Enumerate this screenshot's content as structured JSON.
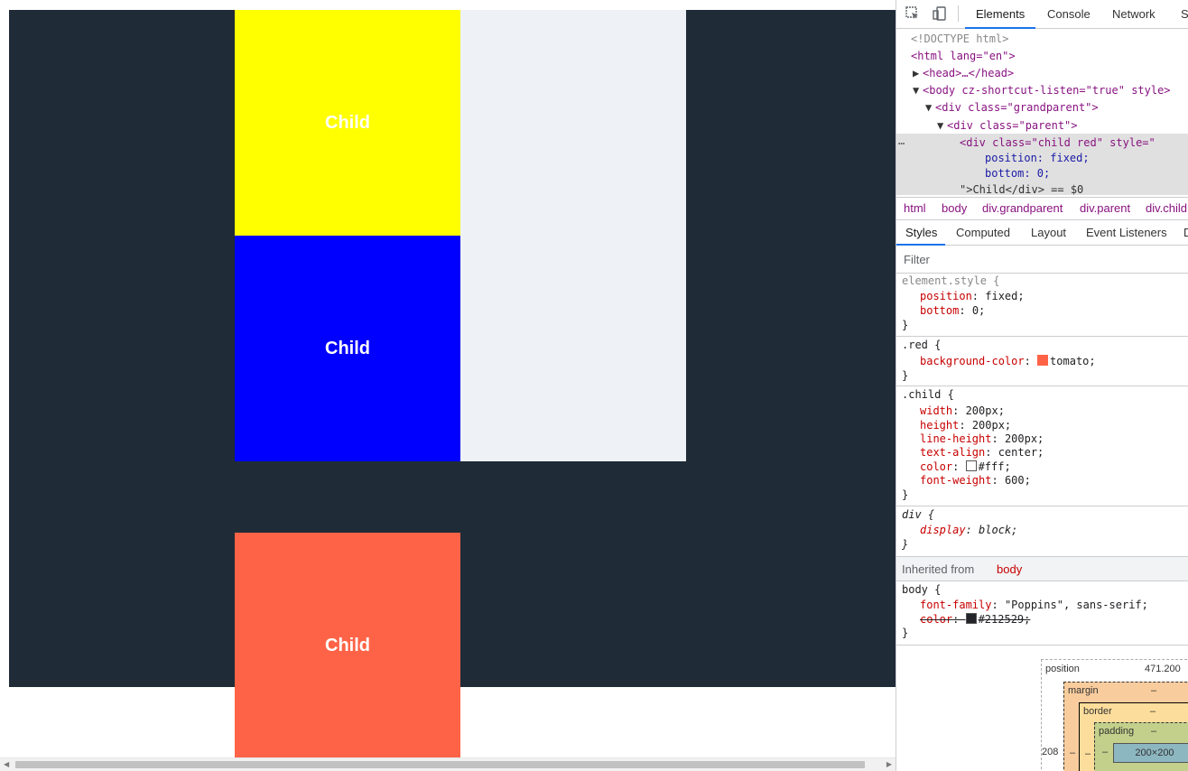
{
  "viewport": {
    "children": [
      {
        "label": "Child",
        "color": "#ffff00"
      },
      {
        "label": "Child",
        "color": "#0000ff"
      },
      {
        "label": "Child",
        "color": "#ff6347"
      }
    ]
  },
  "devtools": {
    "tabs": [
      "Elements",
      "Console",
      "Network",
      "S"
    ],
    "active_tab": "Elements",
    "dom": {
      "doctype": "<!DOCTYPE html>",
      "html_open": "<html lang=\"en\">",
      "head": "<head>…</head>",
      "body_open": "<body cz-shortcut-listen=\"true\" style>",
      "grandparent": "<div class=\"grandparent\">",
      "parent": "<div class=\"parent\">",
      "child_open": "<div class=\"child red\" style=\"",
      "child_style1": "position: fixed;",
      "child_style2": "bottom: 0;",
      "child_close": "\">Child</div> == $0",
      "ellipsis": "…"
    },
    "breadcrumb": [
      "html",
      "body",
      "div.grandparent",
      "div.parent",
      "div.child"
    ],
    "subtabs": [
      "Styles",
      "Computed",
      "Layout",
      "Event Listeners",
      "D"
    ],
    "filter_placeholder": "Filter",
    "rules": {
      "element_style": {
        "selector": "element.style {",
        "props": [
          [
            "position",
            "fixed;"
          ],
          [
            "bottom",
            "0;"
          ]
        ]
      },
      "red": {
        "selector": ".red {",
        "props": [
          [
            "background-color",
            "tomato;"
          ]
        ],
        "swatch": "#ff6347"
      },
      "child": {
        "selector": ".child {",
        "props": [
          [
            "width",
            "200px;"
          ],
          [
            "height",
            "200px;"
          ],
          [
            "line-height",
            "200px;"
          ],
          [
            "text-align",
            "center;"
          ],
          [
            "color",
            "#fff;"
          ],
          [
            "font-weight",
            "600;"
          ]
        ],
        "swatch": "#ffffff"
      },
      "div": {
        "selector": "div {",
        "props": [
          [
            "display",
            "block;"
          ]
        ]
      },
      "inherited_label": "Inherited from",
      "inherited_from": "body",
      "body": {
        "selector": "body {",
        "props": [
          [
            "font-family",
            "\"Poppins\", sans-serif;"
          ],
          [
            "color",
            "#212529;"
          ]
        ],
        "swatch": "#212529"
      },
      "close_brace": "}"
    },
    "box_model": {
      "position_label": "position",
      "position_value": "471.200",
      "margin_label": "margin",
      "border_label": "border",
      "padding_label": "padding",
      "dash": "–",
      "left_value": "208",
      "content": "200×200"
    }
  }
}
